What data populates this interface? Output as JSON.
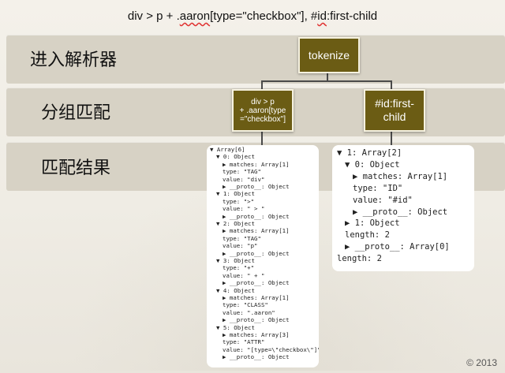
{
  "title": {
    "prefix": "div > p + .",
    "aaron": "aaron",
    "middle": "[type=\"checkbox\"],  #",
    "id": "id",
    "suffix": ":first-child"
  },
  "bands": [
    "进入解析器",
    "分组匹配",
    "匹配结果"
  ],
  "nodes": {
    "root": "tokenize",
    "left_l1": "div > p",
    "left_l2": "+ .aaron[type",
    "left_l3": "=\"checkbox\"]",
    "right_l1": "#id:first-",
    "right_l2": "child"
  },
  "left_panel": [
    {
      "i": 0,
      "t": "▼ Array[6]"
    },
    {
      "i": 1,
      "t": "▼ 0: Object"
    },
    {
      "i": 2,
      "t": "▶ matches: Array[1]"
    },
    {
      "i": 2,
      "t": "type: \"TAG\""
    },
    {
      "i": 2,
      "t": "value: \"div\""
    },
    {
      "i": 2,
      "t": "▶ __proto__: Object"
    },
    {
      "i": 1,
      "t": "▼ 1: Object"
    },
    {
      "i": 2,
      "t": "type: \">\""
    },
    {
      "i": 2,
      "t": "value: \" > \""
    },
    {
      "i": 2,
      "t": "▶ __proto__: Object"
    },
    {
      "i": 1,
      "t": "▼ 2: Object"
    },
    {
      "i": 2,
      "t": "▶ matches: Array[1]"
    },
    {
      "i": 2,
      "t": "type: \"TAG\""
    },
    {
      "i": 2,
      "t": "value: \"p\""
    },
    {
      "i": 2,
      "t": "▶ __proto__: Object"
    },
    {
      "i": 1,
      "t": "▼ 3: Object"
    },
    {
      "i": 2,
      "t": "type: \"+\""
    },
    {
      "i": 2,
      "t": "value: \" + \""
    },
    {
      "i": 2,
      "t": "▶ __proto__: Object"
    },
    {
      "i": 1,
      "t": "▼ 4: Object"
    },
    {
      "i": 2,
      "t": "▶ matches: Array[1]"
    },
    {
      "i": 2,
      "t": "type: \"CLASS\""
    },
    {
      "i": 2,
      "t": "value: \".aaron\""
    },
    {
      "i": 2,
      "t": "▶ __proto__: Object"
    },
    {
      "i": 1,
      "t": "▼ 5: Object"
    },
    {
      "i": 2,
      "t": "▶ matches: Array[3]"
    },
    {
      "i": 2,
      "t": "type: \"ATTR\""
    },
    {
      "i": 2,
      "t": "value: \"[type=\\\"checkbox\\\"]\""
    },
    {
      "i": 2,
      "t": "▶ __proto__: Object"
    }
  ],
  "right_panel": [
    {
      "i": 0,
      "t": "▼ 1: Array[2]"
    },
    {
      "i": 1,
      "t": "▼ 0: Object"
    },
    {
      "i": 2,
      "t": "▶ matches: Array[1]"
    },
    {
      "i": 2,
      "t": "type: \"ID\""
    },
    {
      "i": 2,
      "t": "value: \"#id\""
    },
    {
      "i": 2,
      "t": "▶ __proto__: Object"
    },
    {
      "i": 1,
      "t": "▶ 1: Object"
    },
    {
      "i": 1,
      "t": "length: 2"
    },
    {
      "i": 1,
      "t": "▶ __proto__: Array[0]"
    },
    {
      "i": 0,
      "t": "length: 2"
    }
  ],
  "copyright": "© 2013"
}
